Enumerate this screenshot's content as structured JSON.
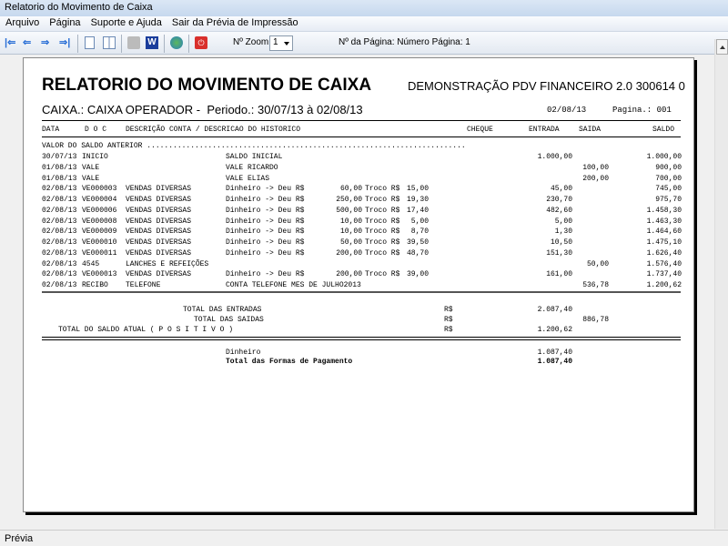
{
  "window": {
    "title": "Relatorio do Movimento de Caixa"
  },
  "menu": [
    "Arquivo",
    "Página",
    "Suporte e Ajuda",
    "Sair da Prévia de Impressão"
  ],
  "toolbar": {
    "zoom_label": "Nº Zoom",
    "zoom_value": "1",
    "page_label": "Nº da Página: Número Página: 1"
  },
  "status": "Prévia",
  "report": {
    "title": "RELATORIO DO MOVIMENTO DE CAIXA",
    "subtitle": "DEMONSTRAÇÃO PDV FINANCEIRO 2.0 300614 0",
    "caixa": "CAIXA.: CAIXA OPERADOR -  Periodo.: 30/07/13 à 02/08/13",
    "date": "02/08/13",
    "page": "Pagina.: 001",
    "headers": {
      "data": "DATA",
      "doc": "D O C",
      "desc": "DESCRIÇÃO CONTA / DESCRICAO DO HISTORICO",
      "cheque": "CHEQUE",
      "entrada": "ENTRADA",
      "saida": "SAIDA",
      "saldo": "SALDO"
    },
    "saldo_anterior": "VALOR DO SALDO ANTERIOR .........................................................................",
    "rows": [
      {
        "date": "30/07/13",
        "doc": "INICIO",
        "conta": "",
        "hist": "SALDO INICIAL",
        "deu": "",
        "troco": "",
        "entrada": "1.000,00",
        "saida": "",
        "saldo": "1.000,00"
      },
      {
        "date": "01/08/13",
        "doc": "VALE",
        "conta": "",
        "hist": "VALE RICARDO",
        "deu": "",
        "troco": "",
        "entrada": "",
        "saida": "100,00",
        "saldo": "900,00"
      },
      {
        "date": "01/08/13",
        "doc": "VALE",
        "conta": "",
        "hist": "VALE ELIAS",
        "deu": "",
        "troco": "",
        "entrada": "",
        "saida": "200,00",
        "saldo": "700,00"
      },
      {
        "date": "02/08/13",
        "doc": "VE000003",
        "conta": "VENDAS DIVERSAS",
        "hist": "Dinheiro -> Deu R$",
        "deu": "60,00",
        "troco": "15,00",
        "entrada": "45,00",
        "saida": "",
        "saldo": "745,00"
      },
      {
        "date": "02/08/13",
        "doc": "VE000004",
        "conta": "VENDAS DIVERSAS",
        "hist": "Dinheiro -> Deu R$",
        "deu": "250,00",
        "troco": "19,30",
        "entrada": "230,70",
        "saida": "",
        "saldo": "975,70"
      },
      {
        "date": "02/08/13",
        "doc": "VE000006",
        "conta": "VENDAS DIVERSAS",
        "hist": "Dinheiro -> Deu R$",
        "deu": "500,00",
        "troco": "17,40",
        "entrada": "482,60",
        "saida": "",
        "saldo": "1.458,30"
      },
      {
        "date": "02/08/13",
        "doc": "VE000008",
        "conta": "VENDAS DIVERSAS",
        "hist": "Dinheiro -> Deu R$",
        "deu": "10,00",
        "troco": "5,00",
        "entrada": "5,00",
        "saida": "",
        "saldo": "1.463,30"
      },
      {
        "date": "02/08/13",
        "doc": "VE000009",
        "conta": "VENDAS DIVERSAS",
        "hist": "Dinheiro -> Deu R$",
        "deu": "10,00",
        "troco": "8,70",
        "entrada": "1,30",
        "saida": "",
        "saldo": "1.464,60"
      },
      {
        "date": "02/08/13",
        "doc": "VE000010",
        "conta": "VENDAS DIVERSAS",
        "hist": "Dinheiro -> Deu R$",
        "deu": "50,00",
        "troco": "39,50",
        "entrada": "10,50",
        "saida": "",
        "saldo": "1.475,10"
      },
      {
        "date": "02/08/13",
        "doc": "VE000011",
        "conta": "VENDAS DIVERSAS",
        "hist": "Dinheiro -> Deu R$",
        "deu": "200,00",
        "troco": "48,70",
        "entrada": "151,30",
        "saida": "",
        "saldo": "1.626,40"
      },
      {
        "date": "02/08/13",
        "doc": "4545",
        "conta": "LANCHES E REFEIÇÕES",
        "hist": "",
        "deu": "",
        "troco": "",
        "entrada": "",
        "saida": "50,00",
        "saldo": "1.576,40"
      },
      {
        "date": "02/08/13",
        "doc": "VE000013",
        "conta": "VENDAS DIVERSAS",
        "hist": "Dinheiro -> Deu R$",
        "deu": "200,00",
        "troco": "39,00",
        "entrada": "161,00",
        "saida": "",
        "saldo": "1.737,40"
      },
      {
        "date": "02/08/13",
        "doc": "RECIBO",
        "conta": "TELEFONE",
        "hist": "CONTA TELEFONE MES DE JULHO2013",
        "deu": "",
        "troco": "",
        "entrada": "",
        "saida": "536,78",
        "saldo": "1.200,62"
      }
    ],
    "troco_label": "Troco R$",
    "totals": {
      "entradas_label": "TOTAL DAS ENTRADAS",
      "entradas": "2.087,40",
      "saidas_label": "TOTAL DAS SAIDAS",
      "saidas": "886,78",
      "saldo_label": "TOTAL DO SALDO ATUAL ( P O S I T I V O )",
      "saldo": "1.200,62",
      "currency": "R$"
    },
    "formas": {
      "dinheiro_label": "Dinheiro",
      "dinheiro": "1.087,40",
      "total_label": "Total das Formas de Pagamento",
      "total": "1.087,40"
    }
  }
}
